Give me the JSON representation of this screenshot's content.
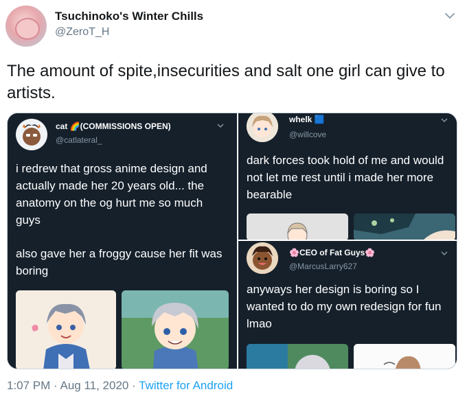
{
  "tweet": {
    "display_name": "Tsuchinoko's Winter Chills",
    "handle": "@ZeroT_H",
    "text": "The amount of spite,insecurities and salt one girl can give to artists.",
    "timestamp": "1:07 PM · Aug 11, 2020 · ",
    "source": "Twitter for Android",
    "link_color": "#1da1f2"
  },
  "embedded": {
    "left": {
      "name": "cat 🌈(COMMISSIONS OPEN)",
      "handle": "@catlateral_",
      "text_1": "i redrew that gross anime design and actually made her 20 years old... the anatomy on the og hurt me so much guys",
      "text_2": "also gave her a froggy cause her fit was boring"
    },
    "top_right": {
      "name": "whelk 🟦",
      "handle": "@willcove",
      "text": "dark forces took hold of me and would not let me rest until i made her more bearable"
    },
    "bottom_right": {
      "name": "🌸CEO of Fat Guys🌸",
      "handle": "@MarcusLarry627",
      "text": "anyways her design is boring so I wanted to do my own redesign for fun lmao"
    }
  },
  "icons": {
    "more": "chevron-down-icon"
  }
}
